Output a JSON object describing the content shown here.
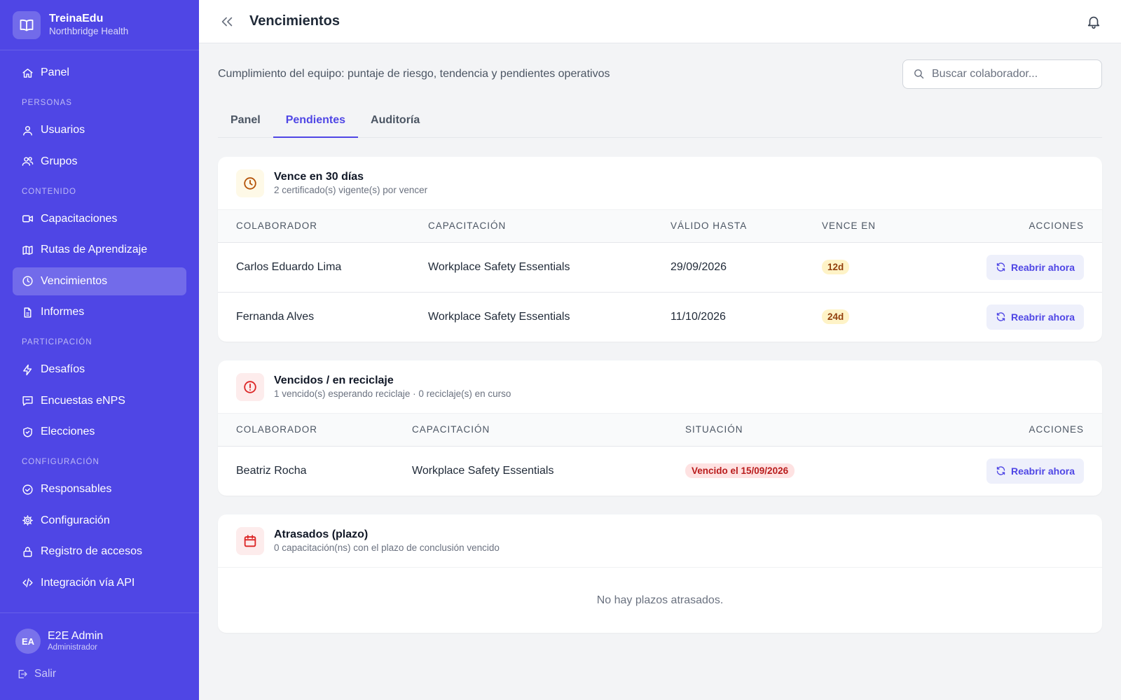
{
  "app": {
    "name": "TreinaEdu",
    "org": "Northbridge Health"
  },
  "sidebar": {
    "items": [
      {
        "label": "Panel",
        "icon": "home-icon"
      },
      {
        "section": "PERSONAS"
      },
      {
        "label": "Usuarios",
        "icon": "user-icon"
      },
      {
        "label": "Grupos",
        "icon": "users-icon"
      },
      {
        "section": "CONTENIDO"
      },
      {
        "label": "Capacitaciones",
        "icon": "video-icon"
      },
      {
        "label": "Rutas de Aprendizaje",
        "icon": "map-icon"
      },
      {
        "label": "Vencimientos",
        "icon": "clock-icon",
        "active": true
      },
      {
        "label": "Informes",
        "icon": "document-icon"
      },
      {
        "section": "PARTICIPACIÓN"
      },
      {
        "label": "Desafíos",
        "icon": "bolt-icon"
      },
      {
        "label": "Encuestas eNPS",
        "icon": "chat-icon"
      },
      {
        "label": "Elecciones",
        "icon": "shield-icon"
      },
      {
        "section": "CONFIGURACIÓN"
      },
      {
        "label": "Responsables",
        "icon": "check-circle-icon"
      },
      {
        "label": "Configuración",
        "icon": "gear-icon"
      },
      {
        "label": "Registro de accesos",
        "icon": "lock-icon"
      },
      {
        "label": "Integración vía API",
        "icon": "code-icon"
      }
    ],
    "user": {
      "initials": "EA",
      "name": "E2E Admin",
      "role": "Administrador"
    },
    "logout": "Salir"
  },
  "topbar": {
    "title": "Vencimientos"
  },
  "main": {
    "subtitle": "Cumplimiento del equipo: puntaje de riesgo, tendencia y pendientes operativos",
    "search_placeholder": "Buscar colaborador...",
    "tabs": [
      {
        "label": "Panel",
        "active": false
      },
      {
        "label": "Pendientes",
        "active": true
      },
      {
        "label": "Auditoría",
        "active": false
      }
    ]
  },
  "expiring": {
    "title": "Vence en 30 días",
    "subtitle": "2 certificado(s) vigente(s) por vencer",
    "columns": [
      "COLABORADOR",
      "CAPACITACIÓN",
      "VÁLIDO HASTA",
      "VENCE EN",
      "ACCIONES"
    ],
    "rows": [
      {
        "collaborator": "Carlos Eduardo Lima",
        "training": "Workplace Safety Essentials",
        "valid_until": "29/09/2026",
        "due_in": "12d",
        "action": "Reabrir ahora"
      },
      {
        "collaborator": "Fernanda Alves",
        "training": "Workplace Safety Essentials",
        "valid_until": "11/10/2026",
        "due_in": "24d",
        "action": "Reabrir ahora"
      }
    ]
  },
  "expired": {
    "title": "Vencidos / en reciclaje",
    "subtitle": "1 vencido(s) esperando reciclaje · 0 reciclaje(s) en curso",
    "columns": [
      "COLABORADOR",
      "CAPACITACIÓN",
      "SITUACIÓN",
      "ACCIONES"
    ],
    "rows": [
      {
        "collaborator": "Beatriz Rocha",
        "training": "Workplace Safety Essentials",
        "status": "Vencido el 15/09/2026",
        "action": "Reabrir ahora"
      }
    ]
  },
  "overdue": {
    "title": "Atrasados (plazo)",
    "subtitle": "0 capacitación(ns) con el plazo de conclusión vencido",
    "empty": "No hay plazos atrasados."
  },
  "colors": {
    "accent": "#4f46e5",
    "sidebar_bg": "#4f46e5",
    "warning_bg": "#fef3c7",
    "warning_text": "#92400e",
    "danger_bg": "#fee2e2",
    "danger_text": "#b91c1c"
  }
}
